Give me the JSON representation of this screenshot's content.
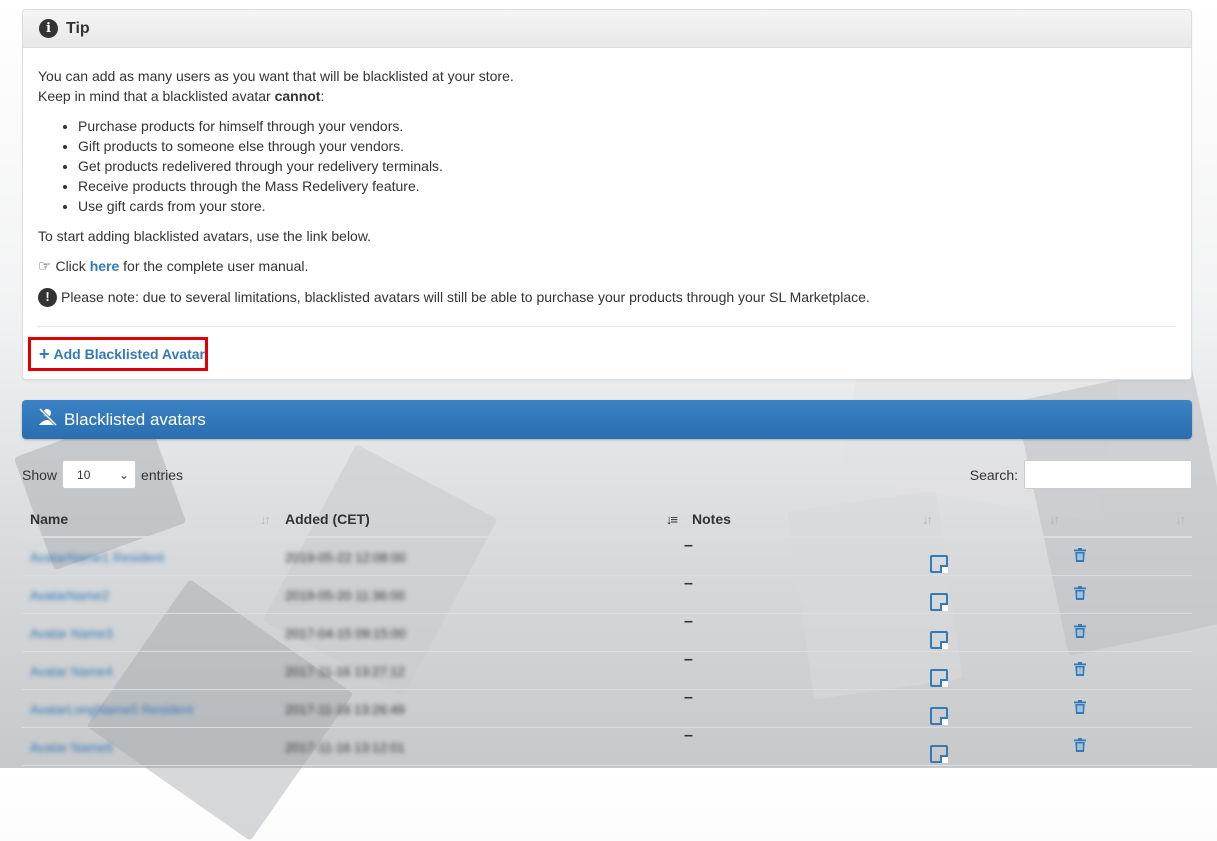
{
  "tip": {
    "title": "Tip",
    "intro_line1": "You can add as many users as you want that will be blacklisted at your store.",
    "intro_line2_prefix": "Keep in mind that a blacklisted avatar ",
    "intro_line2_bold": "cannot",
    "intro_line2_suffix": ":",
    "items": [
      "Purchase products for himself through your vendors.",
      "Gift products to someone else through your vendors.",
      "Get products redelivered through your redelivery terminals.",
      "Receive products through the Mass Redelivery feature.",
      "Use gift cards from your store."
    ],
    "start_text": "To start adding blacklisted avatars, use the link below.",
    "manual_prefix": "Click ",
    "manual_link": "here",
    "manual_suffix": " for the complete user manual.",
    "note_text": "Please note: due to several limitations, blacklisted avatars will still be able to purchase your products through your SL Marketplace.",
    "add_button": "Add Blacklisted Avatar"
  },
  "blacklist": {
    "title": "Blacklisted avatars",
    "show_label": "Show",
    "entries_label": "entries",
    "page_size": "10",
    "search_label": "Search:",
    "columns": [
      "Name",
      "Added (CET)",
      "Notes",
      "",
      ""
    ],
    "rows": [
      {
        "name": "AvatarName1 Resident",
        "added": "2019-05-22 12:08:00",
        "notes": "–"
      },
      {
        "name": "AvatarName2",
        "added": "2019-05-20 11:36:00",
        "notes": "–"
      },
      {
        "name": "Avatar Name3",
        "added": "2017-04-15 09:15:00",
        "notes": "–"
      },
      {
        "name": "Avatar Name4",
        "added": "2017-11-16 13:27:12",
        "notes": "–"
      },
      {
        "name": "AvatarLongName5 Resident",
        "added": "2017-11-16 13:26:49",
        "notes": "–"
      },
      {
        "name": "Avatar Name6",
        "added": "2017-11-16 13:12:01",
        "notes": "–"
      }
    ]
  }
}
